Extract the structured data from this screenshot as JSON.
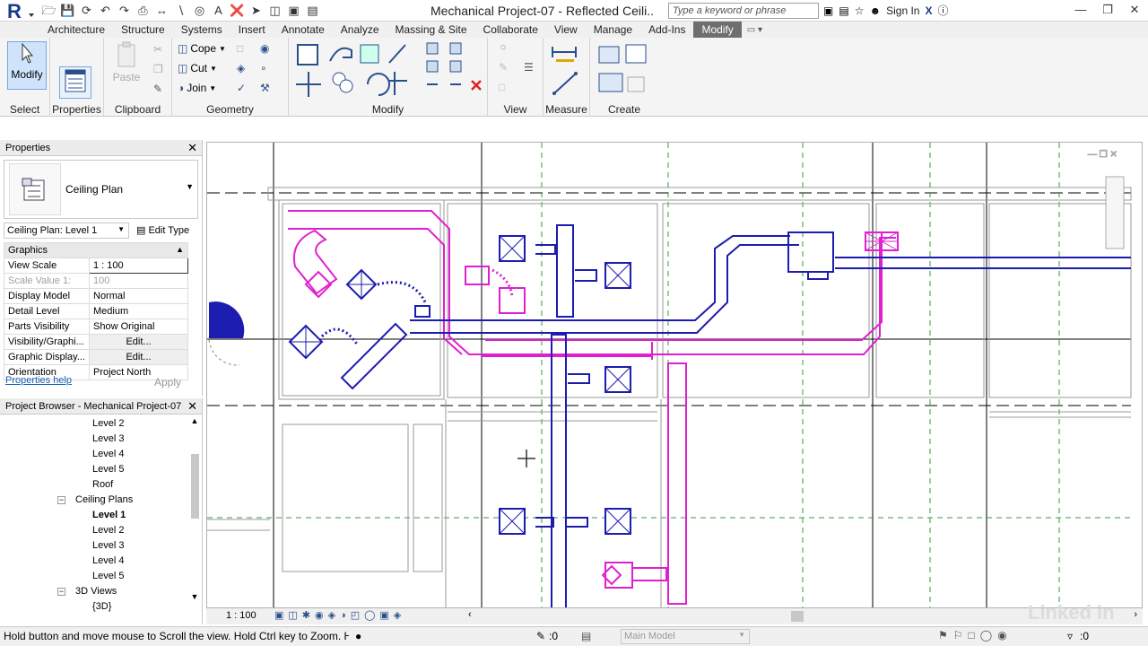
{
  "window": {
    "title": "Mechanical Project-07 - Reflected Ceili...",
    "search_placeholder": "Type a keyword or phrase",
    "sign_in": "Sign In"
  },
  "tabs": [
    "Architecture",
    "Structure",
    "Systems",
    "Insert",
    "Annotate",
    "Analyze",
    "Massing & Site",
    "Collaborate",
    "View",
    "Manage",
    "Add-Ins",
    "Modify"
  ],
  "active_tab": "Modify",
  "ribbon": {
    "modify_label": "Modify",
    "paste_label": "Paste",
    "cope_label": "Cope",
    "cut_label": "Cut",
    "join_label": "Join",
    "panels": {
      "select": "Select",
      "properties": "Properties",
      "clipboard": "Clipboard",
      "geometry": "Geometry",
      "modify": "Modify",
      "view": "View",
      "measure": "Measure",
      "create": "Create"
    }
  },
  "properties": {
    "header": "Properties",
    "type_name": "Ceiling Plan",
    "instance_selector": "Ceiling Plan: Level 1",
    "edit_type": "Edit Type",
    "category": "Graphics",
    "rows": [
      {
        "key": "View Scale",
        "value": "1 : 100"
      },
      {
        "key": "Scale Value    1:",
        "value": "100"
      },
      {
        "key": "Display Model",
        "value": "Normal"
      },
      {
        "key": "Detail Level",
        "value": "Medium"
      },
      {
        "key": "Parts Visibility",
        "value": "Show Original"
      },
      {
        "key": "Visibility/Graphi...",
        "value": "Edit..."
      },
      {
        "key": "Graphic Display...",
        "value": "Edit..."
      },
      {
        "key": "Orientation",
        "value": "Project North"
      }
    ],
    "help_link": "Properties help",
    "apply": "Apply"
  },
  "project_browser": {
    "header": "Project Browser - Mechanical Project-07",
    "items": [
      {
        "label": "Level 2",
        "indent": 2
      },
      {
        "label": "Level 3",
        "indent": 2
      },
      {
        "label": "Level 4",
        "indent": 2
      },
      {
        "label": "Level 5",
        "indent": 2
      },
      {
        "label": "Roof",
        "indent": 2
      },
      {
        "label": "Ceiling Plans",
        "indent": 1
      },
      {
        "label": "Level 1",
        "indent": 2
      },
      {
        "label": "Level 2",
        "indent": 2
      },
      {
        "label": "Level 3",
        "indent": 2
      },
      {
        "label": "Level 4",
        "indent": 2
      },
      {
        "label": "Level 5",
        "indent": 2
      },
      {
        "label": "3D Views",
        "indent": 1
      },
      {
        "label": "{3D}",
        "indent": 2
      }
    ]
  },
  "view_controls": {
    "scale": "1 : 100"
  },
  "status": {
    "message": "Hold button and move mouse to Scroll the view. Hold Ctrl key to Zoom. Hold Shift key to Rotate.",
    "zero": ":0",
    "model": "Main Model",
    "filter_count": ":0"
  },
  "watermark": "Linked in",
  "colors": {
    "duct_supply": "#e020d0",
    "duct_return": "#1c1cb0",
    "grid": "#3a9a3a",
    "tab_active": "#6e6e6e"
  }
}
